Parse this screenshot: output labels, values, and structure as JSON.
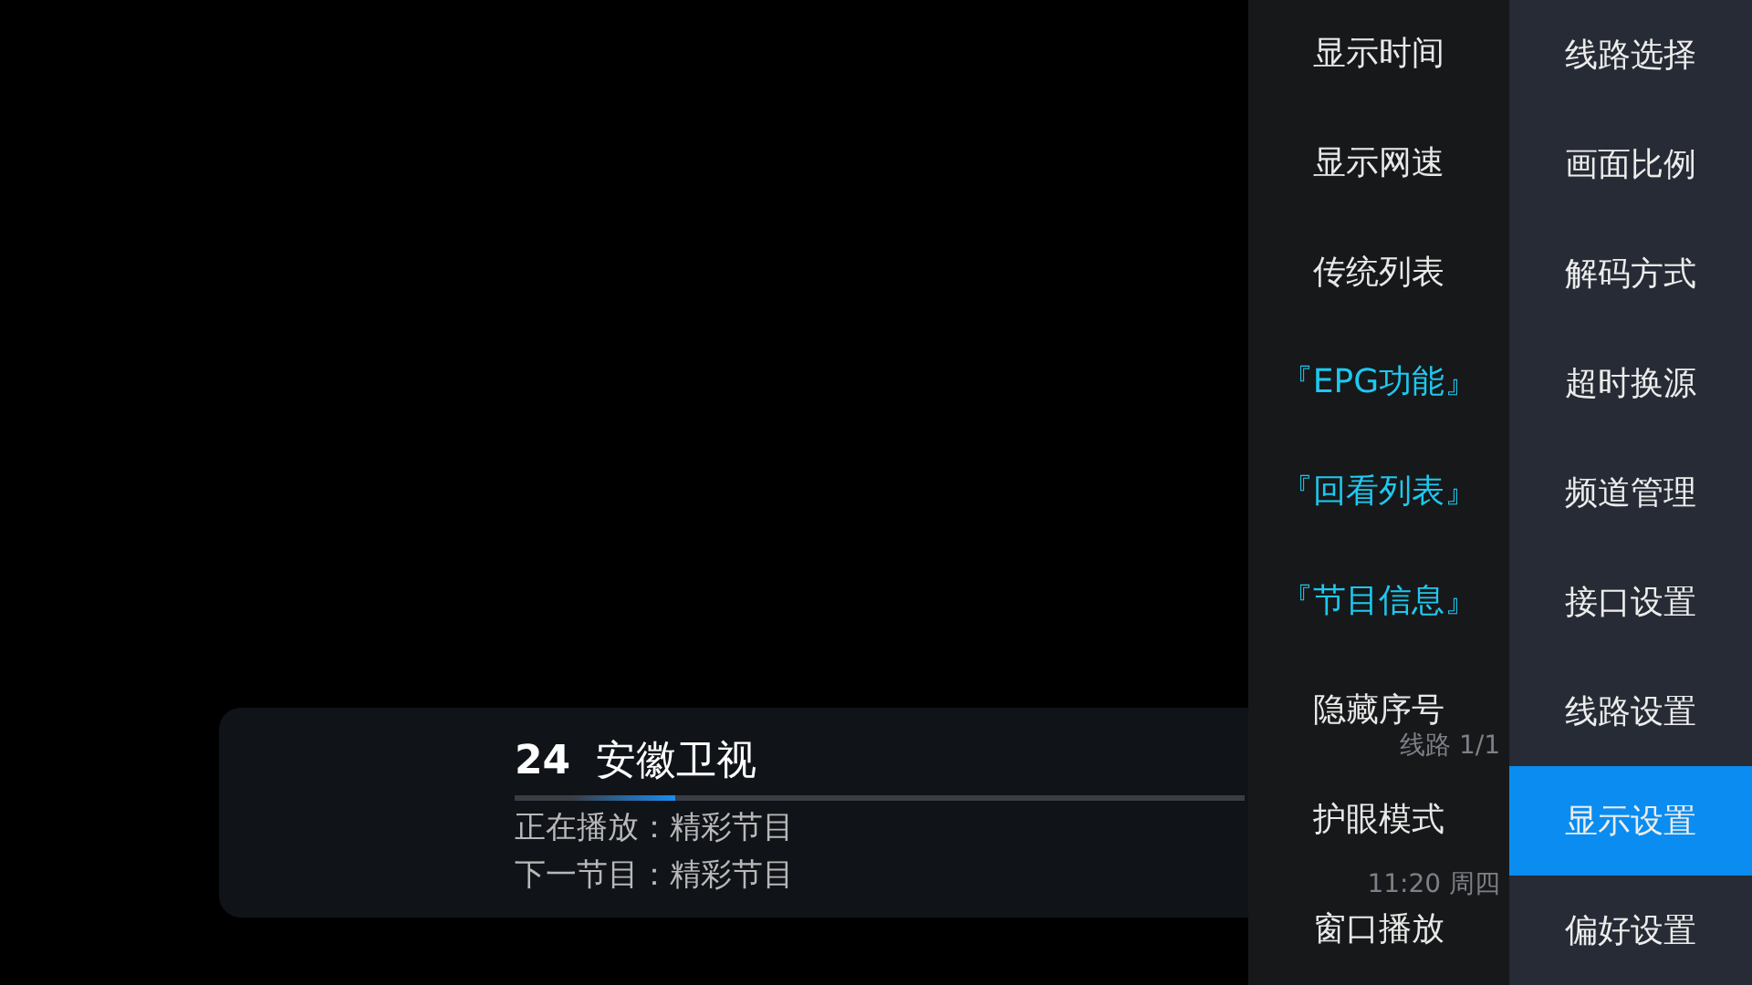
{
  "info_bar": {
    "channel_number": "24",
    "channel_name": "安徽卫视",
    "progress": {
      "level": 0.22
    },
    "now_playing": "正在播放：精彩节目",
    "next_program": "下一节目：精彩节目",
    "route": "线路 1/1",
    "time": "11:20 周四"
  },
  "menu": {
    "options": [
      {
        "label": "显示时间",
        "highlighted": false
      },
      {
        "label": "显示网速",
        "highlighted": false
      },
      {
        "label": "传统列表",
        "highlighted": false
      },
      {
        "label": "『EPG功能』",
        "highlighted": true
      },
      {
        "label": "『回看列表』",
        "highlighted": true
      },
      {
        "label": "『节目信息』",
        "highlighted": true
      },
      {
        "label": "隐藏序号",
        "highlighted": false
      },
      {
        "label": "护眼模式",
        "highlighted": false
      },
      {
        "label": "窗口播放",
        "highlighted": false
      }
    ],
    "categories": [
      {
        "label": "线路选择",
        "selected": false
      },
      {
        "label": "画面比例",
        "selected": false
      },
      {
        "label": "解码方式",
        "selected": false
      },
      {
        "label": "超时换源",
        "selected": false
      },
      {
        "label": "频道管理",
        "selected": false
      },
      {
        "label": "接口设置",
        "selected": false
      },
      {
        "label": "线路设置",
        "selected": false
      },
      {
        "label": "显示设置",
        "selected": true
      },
      {
        "label": "偏好设置",
        "selected": false
      }
    ]
  }
}
